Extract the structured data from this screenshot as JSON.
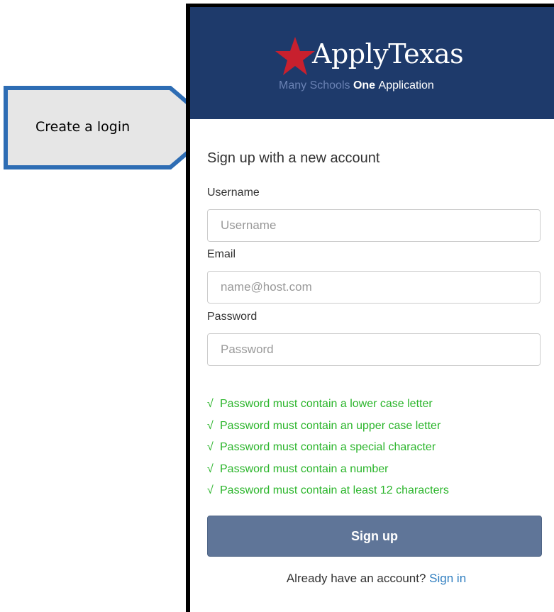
{
  "callout": {
    "text": "Create a login"
  },
  "brand": {
    "title": "ApplyTexas",
    "tagline_many": "Many Schools",
    "tagline_one": "One",
    "tagline_app": "Application",
    "star_color": "#c8202e",
    "banner_color": "#1e3a6b"
  },
  "form": {
    "heading": "Sign up with a new account",
    "username_label": "Username",
    "username_placeholder": "Username",
    "email_label": "Email",
    "email_placeholder": "name@host.com",
    "password_label": "Password",
    "password_placeholder": "Password",
    "rules": [
      "Password must contain a lower case letter",
      "Password must contain an upper case letter",
      "Password must contain a special character",
      "Password must contain a number",
      "Password must contain at least 12 characters"
    ],
    "rule_check": "√",
    "signup_label": "Sign up",
    "signin_prompt": "Already have an account?",
    "signin_link": "Sign in"
  }
}
